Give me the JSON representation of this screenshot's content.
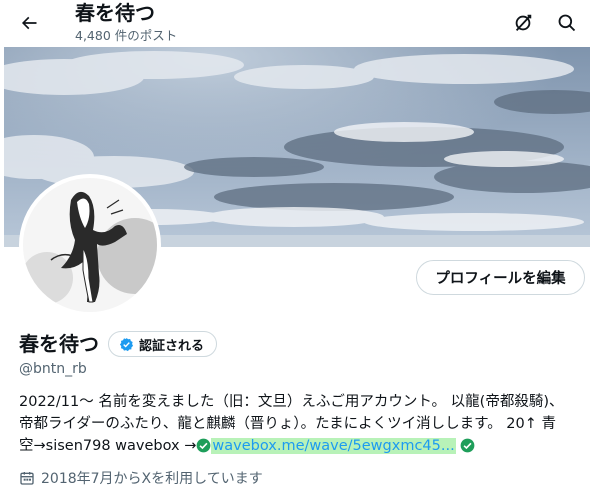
{
  "header": {
    "title": "春を待つ",
    "post_count": "4,480 件のポスト"
  },
  "profile": {
    "display_name": "春を待つ",
    "verify_label": "認証される",
    "handle": "@bntn_rb",
    "edit_button": "プロフィールを編集",
    "bio": {
      "line1": "2022/11～ 名前を変えました（旧：文旦）えふご用アカウント。 以龍(帝都殺騎)、",
      "line2": "帝都ライダーのふたり、龍と麒麟（晋りょ）。たまによくツイ消しします。 20↑ 青",
      "line3_prefix": "空→sisen798 wavebox →",
      "link": "wavebox.me/wave/5ewgxmc45..."
    },
    "joined": "2018年7月からXを利用しています"
  },
  "colors": {
    "accent": "#1d9bf0",
    "check_green": "#1e9e5a",
    "muted": "#536471",
    "link_highlight": "#b8f2b8"
  },
  "icons": {
    "back": "arrow-left-icon",
    "grok": "grok-icon",
    "search": "search-icon",
    "verified": "verified-badge-icon",
    "calendar": "calendar-icon"
  }
}
